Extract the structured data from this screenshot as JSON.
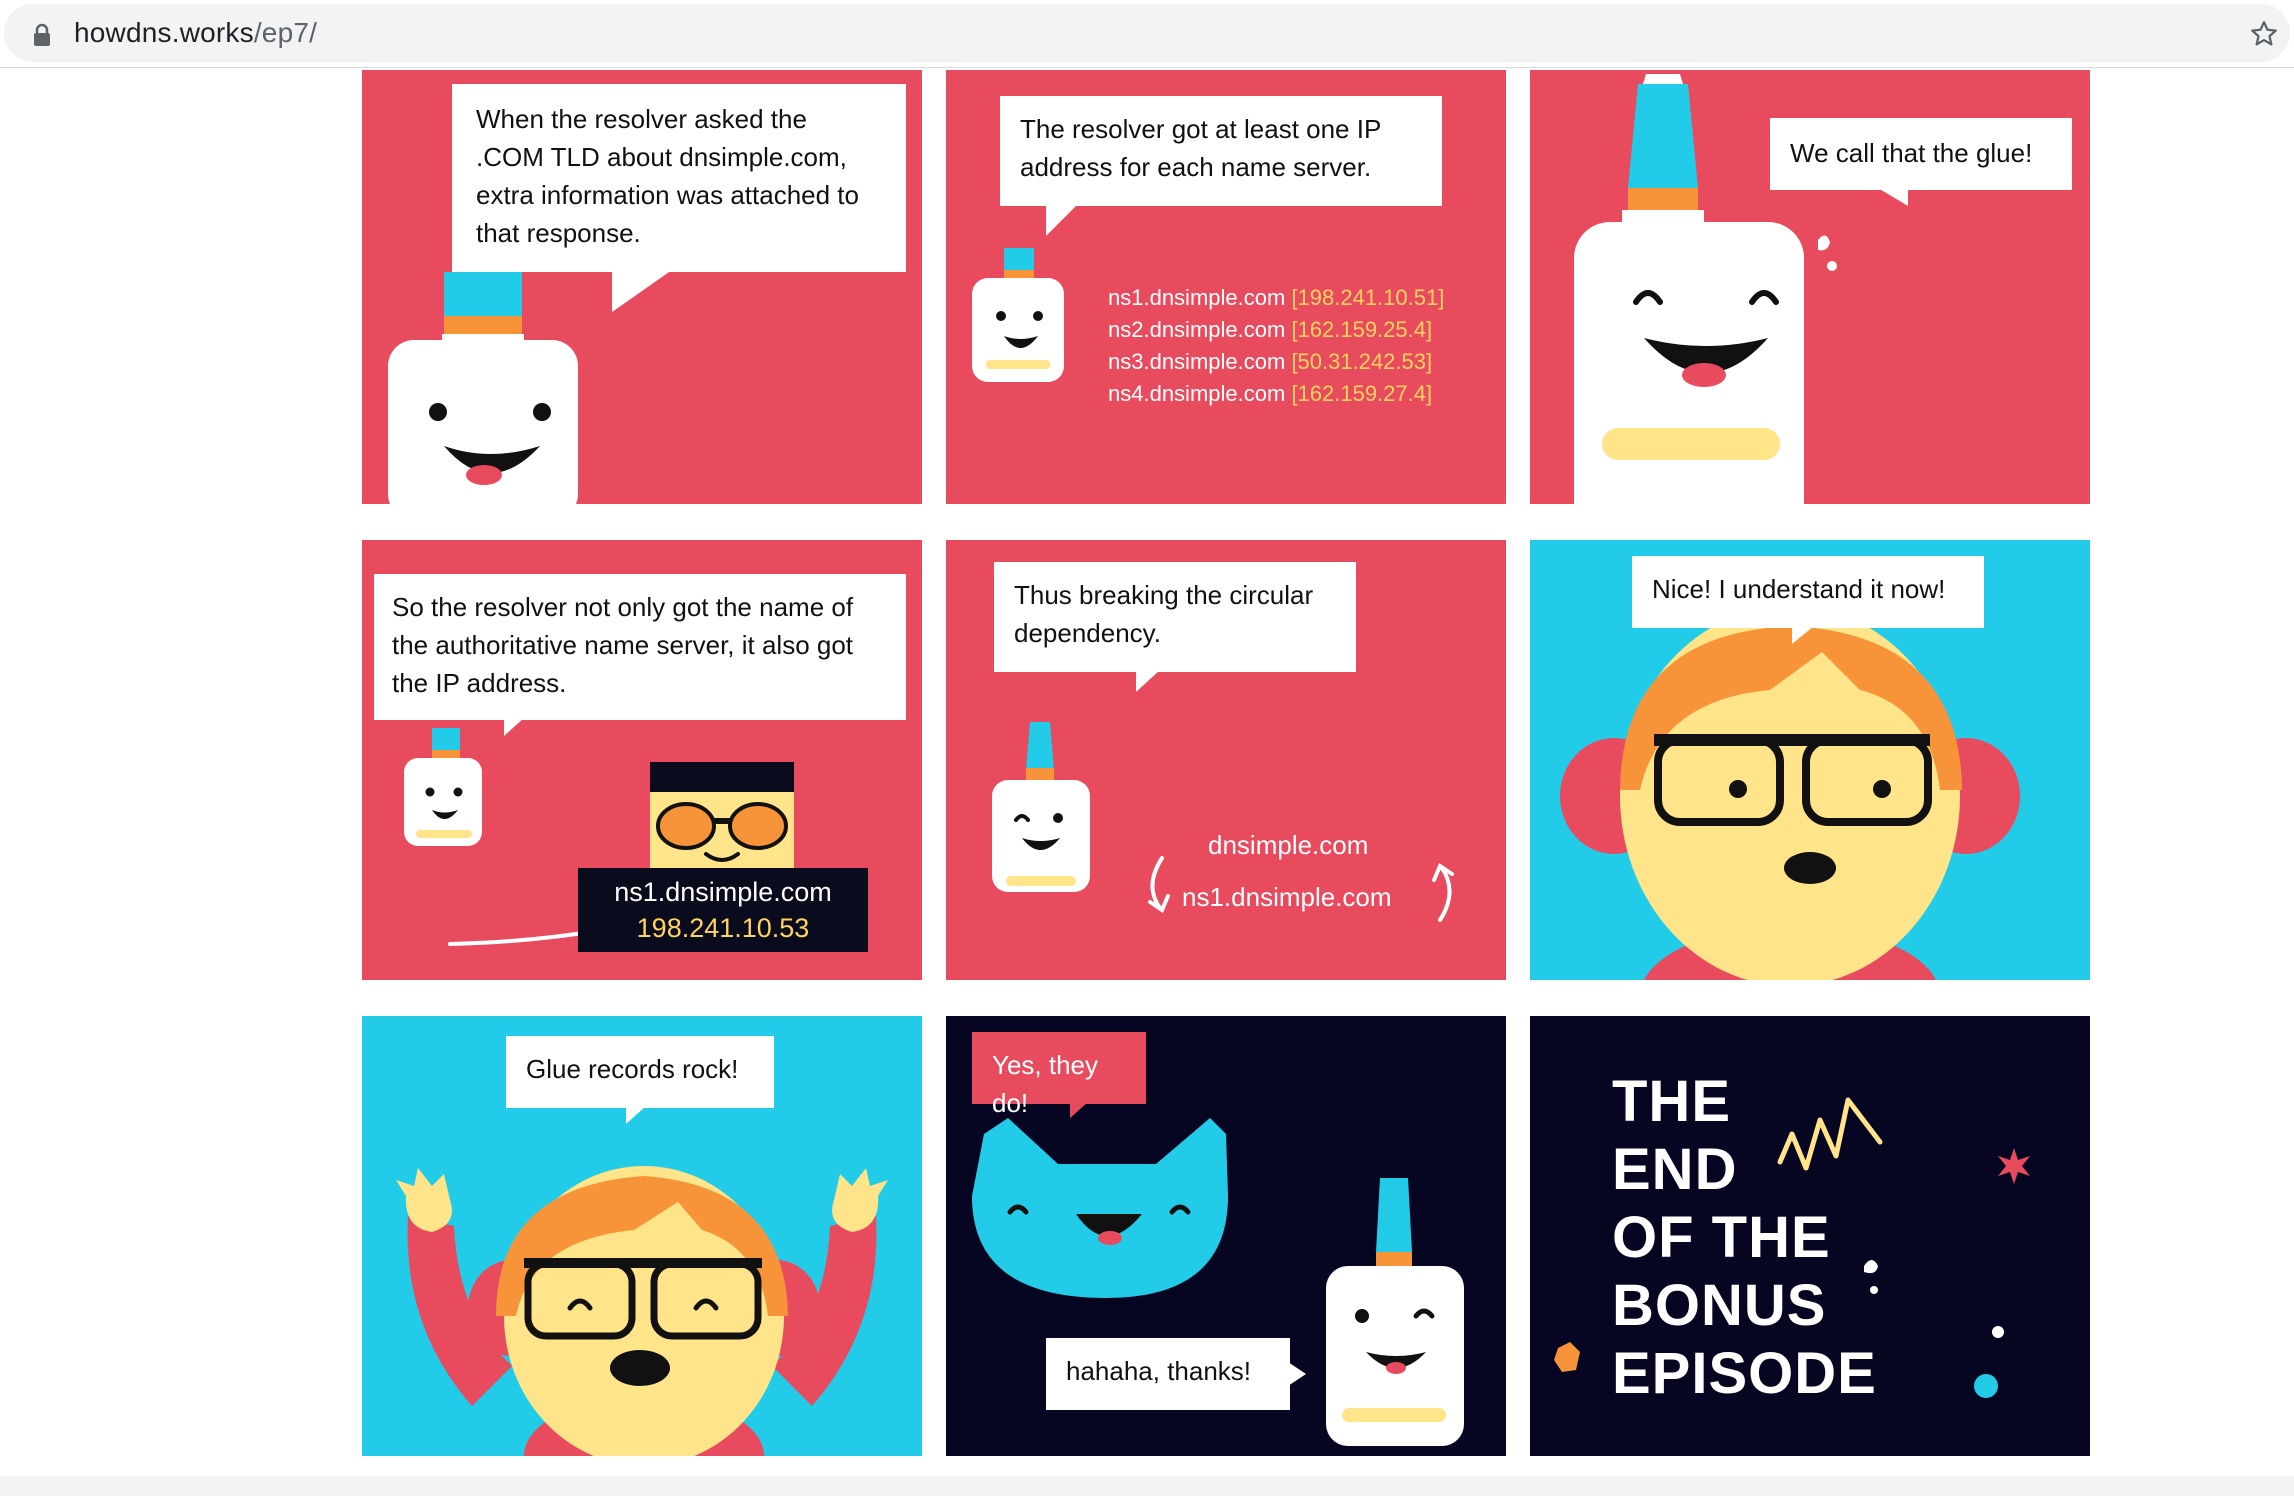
{
  "browser": {
    "url_host": "howdns.works",
    "url_path": "/ep7/",
    "icons": [
      "lock-icon",
      "bookmark-star-icon"
    ]
  },
  "colors": {
    "panel_red": "#e84b5e",
    "panel_cyan": "#22cce8",
    "panel_navy": "#060622",
    "highlight_yellow": "#ffd45e"
  },
  "panels": {
    "p1": {
      "bubble": "When the resolver asked the .COM TLD about dnsimple.com, extra information was attached to that response."
    },
    "p2": {
      "bubble": "The resolver got at least one IP address for each name server.",
      "records": [
        {
          "name": "ns1.dnsimple.com",
          "ip": "[198.241.10.51]"
        },
        {
          "name": "ns2.dnsimple.com",
          "ip": "[162.159.25.4]"
        },
        {
          "name": "ns3.dnsimple.com",
          "ip": "[50.31.242.53]"
        },
        {
          "name": "ns4.dnsimple.com",
          "ip": "[162.159.27.4]"
        }
      ]
    },
    "p3": {
      "bubble": "We call that the glue!"
    },
    "p4": {
      "bubble": "So the resolver not only got the name of the authoritative name server, it also got the IP address.",
      "tag_name": "ns1.dnsimple.com",
      "tag_ip": "198.241.10.53"
    },
    "p5": {
      "bubble": "Thus breaking the circular dependency.",
      "loop_top": "dnsimple.com",
      "loop_bottom": "ns1.dnsimple.com"
    },
    "p6": {
      "bubble": "Nice! I understand it now!"
    },
    "p7": {
      "bubble": "Glue records rock!"
    },
    "p8": {
      "bubble_top": "Yes, they do!",
      "bubble_bottom": "hahaha, thanks!"
    },
    "p9": {
      "end_lines": [
        "THE",
        "END",
        "OF THE",
        "BONUS",
        "EPISODE"
      ]
    }
  }
}
